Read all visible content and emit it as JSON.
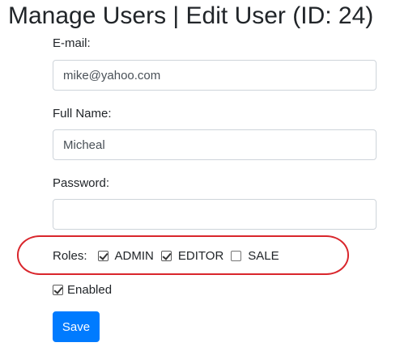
{
  "page": {
    "title": "Manage Users | Edit User (ID: 24)"
  },
  "form": {
    "email": {
      "label": "E-mail:",
      "value": "mike@yahoo.com",
      "placeholder": ""
    },
    "full_name": {
      "label": "Full Name:",
      "value": "Micheal",
      "placeholder": ""
    },
    "password": {
      "label": "Password:",
      "value": "",
      "placeholder": ""
    },
    "roles": {
      "label": "Roles:",
      "options": [
        {
          "label": "ADMIN",
          "checked": true
        },
        {
          "label": "EDITOR",
          "checked": true
        },
        {
          "label": "SALE",
          "checked": false
        }
      ]
    },
    "enabled": {
      "label": "Enabled",
      "checked": true
    },
    "save_label": "Save"
  },
  "colors": {
    "primary": "#007bff",
    "highlight": "#d9262c",
    "text": "#212529",
    "border": "#ced4da"
  }
}
